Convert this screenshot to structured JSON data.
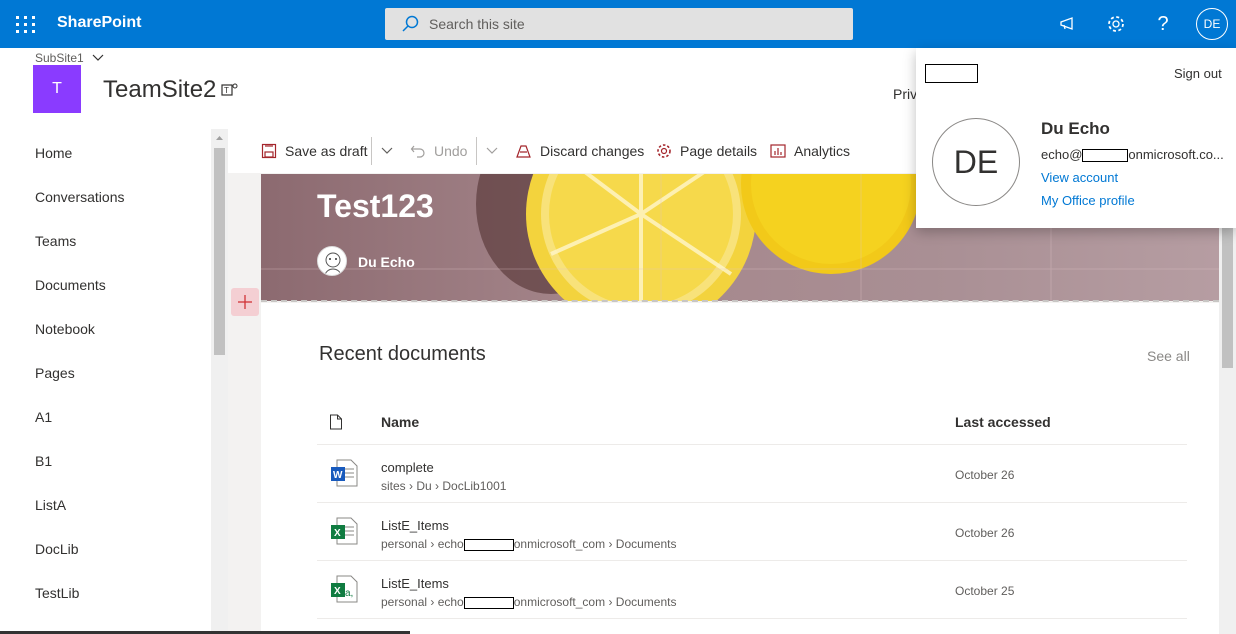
{
  "suite": {
    "app_name": "SharePoint",
    "search_placeholder": "Search this site",
    "avatar_initials": "DE"
  },
  "site": {
    "subsite_label": "SubSite1",
    "logo_letter": "T",
    "title": "TeamSite2",
    "privacy_partial": "Priv",
    "logo_color": "#8a3bff"
  },
  "nav": {
    "items": [
      "Home",
      "Conversations",
      "Teams",
      "Documents",
      "Notebook",
      "Pages",
      "A1",
      "B1",
      "ListA",
      "DocLib",
      "TestLib"
    ]
  },
  "commands": {
    "save_draft": "Save as draft",
    "undo": "Undo",
    "discard": "Discard changes",
    "page_details": "Page details",
    "analytics": "Analytics"
  },
  "hero": {
    "page_title": "Test123",
    "author": "Du Echo"
  },
  "recent": {
    "title": "Recent documents",
    "see_all": "See all",
    "col_name": "Name",
    "col_last": "Last accessed",
    "rows": [
      {
        "name": "complete",
        "path_a": "sites",
        "path_b": "Du",
        "path_c": "DocLib1001",
        "date": "October 26",
        "icon": "word-icon"
      },
      {
        "name": "ListE_Items",
        "path_a": "personal",
        "path_b_pre": "echo",
        "path_b_post": "onmicrosoft_com",
        "path_c": "Documents",
        "date": "October 26",
        "icon": "excel-icon"
      },
      {
        "name": "ListE_Items",
        "path_a": "personal",
        "path_b_pre": "echo",
        "path_b_post": "onmicrosoft_com",
        "path_c": "Documents",
        "date": "October 25",
        "icon": "excel-icon"
      }
    ]
  },
  "account": {
    "sign_out": "Sign out",
    "initials": "DE",
    "name": "Du Echo",
    "email_pre": "echo@",
    "email_post": "onmicrosoft.co...",
    "view_account": "View account",
    "office_profile": "My Office profile"
  }
}
